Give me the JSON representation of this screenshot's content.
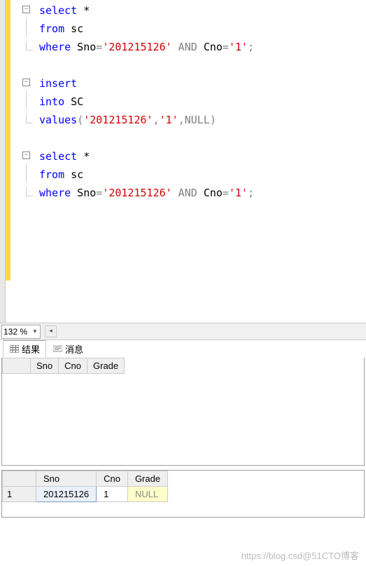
{
  "code": {
    "l1_select": "select",
    "l1_star": " *",
    "l2_from": "from",
    "l2_tbl": " sc",
    "l3_where": "where",
    "l3_col1": " Sno",
    "l3_eq": "=",
    "l3_val1": "'201215126'",
    "l3_and": " AND ",
    "l3_col2": "Cno",
    "l3_val2": "'1'",
    "l3_end": ";",
    "l5_insert": "insert",
    "l6_into": "into",
    "l6_tbl": " SC",
    "l7_values": "values",
    "l7_open": "(",
    "l7_v1": "'201215126'",
    "l7_c": ",",
    "l7_v2": "'1'",
    "l7_null": "NULL",
    "l7_close": ")",
    "l9_select": "select",
    "l9_star": " *",
    "l10_from": "from",
    "l10_tbl": " sc",
    "l11_where": "where",
    "l11_col1": " Sno",
    "l11_eq": "=",
    "l11_val1": "'201215126'",
    "l11_and": " AND ",
    "l11_col2": "Cno",
    "l11_val2": "'1'",
    "l11_end": ";"
  },
  "zoom": {
    "value": "132 %"
  },
  "tabs": {
    "results": "结果",
    "messages": "消息"
  },
  "grid1": {
    "headers": {
      "h0": "",
      "h1": "Sno",
      "h2": "Cno",
      "h3": "Grade"
    }
  },
  "grid2": {
    "headers": {
      "h0": "",
      "h1": "Sno",
      "h2": "Cno",
      "h3": "Grade"
    },
    "row": {
      "n": "1",
      "sno": "201215126",
      "cno": "1",
      "grade": "NULL"
    }
  },
  "watermark": "https://blog.csd@51CTO博客"
}
